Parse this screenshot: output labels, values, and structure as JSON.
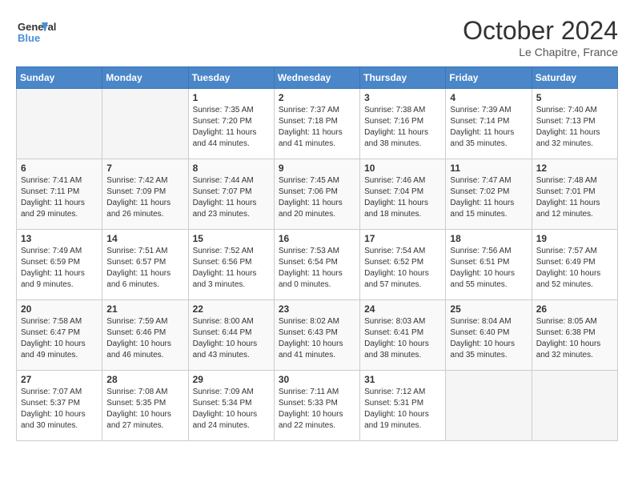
{
  "header": {
    "logo_line1": "General",
    "logo_line2": "Blue",
    "month": "October 2024",
    "location": "Le Chapitre, France"
  },
  "weekdays": [
    "Sunday",
    "Monday",
    "Tuesday",
    "Wednesday",
    "Thursday",
    "Friday",
    "Saturday"
  ],
  "weeks": [
    [
      {
        "day": "",
        "empty": true
      },
      {
        "day": "",
        "empty": true
      },
      {
        "day": "1",
        "sunrise": "Sunrise: 7:35 AM",
        "sunset": "Sunset: 7:20 PM",
        "daylight": "Daylight: 11 hours and 44 minutes."
      },
      {
        "day": "2",
        "sunrise": "Sunrise: 7:37 AM",
        "sunset": "Sunset: 7:18 PM",
        "daylight": "Daylight: 11 hours and 41 minutes."
      },
      {
        "day": "3",
        "sunrise": "Sunrise: 7:38 AM",
        "sunset": "Sunset: 7:16 PM",
        "daylight": "Daylight: 11 hours and 38 minutes."
      },
      {
        "day": "4",
        "sunrise": "Sunrise: 7:39 AM",
        "sunset": "Sunset: 7:14 PM",
        "daylight": "Daylight: 11 hours and 35 minutes."
      },
      {
        "day": "5",
        "sunrise": "Sunrise: 7:40 AM",
        "sunset": "Sunset: 7:13 PM",
        "daylight": "Daylight: 11 hours and 32 minutes."
      }
    ],
    [
      {
        "day": "6",
        "sunrise": "Sunrise: 7:41 AM",
        "sunset": "Sunset: 7:11 PM",
        "daylight": "Daylight: 11 hours and 29 minutes."
      },
      {
        "day": "7",
        "sunrise": "Sunrise: 7:42 AM",
        "sunset": "Sunset: 7:09 PM",
        "daylight": "Daylight: 11 hours and 26 minutes."
      },
      {
        "day": "8",
        "sunrise": "Sunrise: 7:44 AM",
        "sunset": "Sunset: 7:07 PM",
        "daylight": "Daylight: 11 hours and 23 minutes."
      },
      {
        "day": "9",
        "sunrise": "Sunrise: 7:45 AM",
        "sunset": "Sunset: 7:06 PM",
        "daylight": "Daylight: 11 hours and 20 minutes."
      },
      {
        "day": "10",
        "sunrise": "Sunrise: 7:46 AM",
        "sunset": "Sunset: 7:04 PM",
        "daylight": "Daylight: 11 hours and 18 minutes."
      },
      {
        "day": "11",
        "sunrise": "Sunrise: 7:47 AM",
        "sunset": "Sunset: 7:02 PM",
        "daylight": "Daylight: 11 hours and 15 minutes."
      },
      {
        "day": "12",
        "sunrise": "Sunrise: 7:48 AM",
        "sunset": "Sunset: 7:01 PM",
        "daylight": "Daylight: 11 hours and 12 minutes."
      }
    ],
    [
      {
        "day": "13",
        "sunrise": "Sunrise: 7:49 AM",
        "sunset": "Sunset: 6:59 PM",
        "daylight": "Daylight: 11 hours and 9 minutes."
      },
      {
        "day": "14",
        "sunrise": "Sunrise: 7:51 AM",
        "sunset": "Sunset: 6:57 PM",
        "daylight": "Daylight: 11 hours and 6 minutes."
      },
      {
        "day": "15",
        "sunrise": "Sunrise: 7:52 AM",
        "sunset": "Sunset: 6:56 PM",
        "daylight": "Daylight: 11 hours and 3 minutes."
      },
      {
        "day": "16",
        "sunrise": "Sunrise: 7:53 AM",
        "sunset": "Sunset: 6:54 PM",
        "daylight": "Daylight: 11 hours and 0 minutes."
      },
      {
        "day": "17",
        "sunrise": "Sunrise: 7:54 AM",
        "sunset": "Sunset: 6:52 PM",
        "daylight": "Daylight: 10 hours and 57 minutes."
      },
      {
        "day": "18",
        "sunrise": "Sunrise: 7:56 AM",
        "sunset": "Sunset: 6:51 PM",
        "daylight": "Daylight: 10 hours and 55 minutes."
      },
      {
        "day": "19",
        "sunrise": "Sunrise: 7:57 AM",
        "sunset": "Sunset: 6:49 PM",
        "daylight": "Daylight: 10 hours and 52 minutes."
      }
    ],
    [
      {
        "day": "20",
        "sunrise": "Sunrise: 7:58 AM",
        "sunset": "Sunset: 6:47 PM",
        "daylight": "Daylight: 10 hours and 49 minutes."
      },
      {
        "day": "21",
        "sunrise": "Sunrise: 7:59 AM",
        "sunset": "Sunset: 6:46 PM",
        "daylight": "Daylight: 10 hours and 46 minutes."
      },
      {
        "day": "22",
        "sunrise": "Sunrise: 8:00 AM",
        "sunset": "Sunset: 6:44 PM",
        "daylight": "Daylight: 10 hours and 43 minutes."
      },
      {
        "day": "23",
        "sunrise": "Sunrise: 8:02 AM",
        "sunset": "Sunset: 6:43 PM",
        "daylight": "Daylight: 10 hours and 41 minutes."
      },
      {
        "day": "24",
        "sunrise": "Sunrise: 8:03 AM",
        "sunset": "Sunset: 6:41 PM",
        "daylight": "Daylight: 10 hours and 38 minutes."
      },
      {
        "day": "25",
        "sunrise": "Sunrise: 8:04 AM",
        "sunset": "Sunset: 6:40 PM",
        "daylight": "Daylight: 10 hours and 35 minutes."
      },
      {
        "day": "26",
        "sunrise": "Sunrise: 8:05 AM",
        "sunset": "Sunset: 6:38 PM",
        "daylight": "Daylight: 10 hours and 32 minutes."
      }
    ],
    [
      {
        "day": "27",
        "sunrise": "Sunrise: 7:07 AM",
        "sunset": "Sunset: 5:37 PM",
        "daylight": "Daylight: 10 hours and 30 minutes."
      },
      {
        "day": "28",
        "sunrise": "Sunrise: 7:08 AM",
        "sunset": "Sunset: 5:35 PM",
        "daylight": "Daylight: 10 hours and 27 minutes."
      },
      {
        "day": "29",
        "sunrise": "Sunrise: 7:09 AM",
        "sunset": "Sunset: 5:34 PM",
        "daylight": "Daylight: 10 hours and 24 minutes."
      },
      {
        "day": "30",
        "sunrise": "Sunrise: 7:11 AM",
        "sunset": "Sunset: 5:33 PM",
        "daylight": "Daylight: 10 hours and 22 minutes."
      },
      {
        "day": "31",
        "sunrise": "Sunrise: 7:12 AM",
        "sunset": "Sunset: 5:31 PM",
        "daylight": "Daylight: 10 hours and 19 minutes."
      },
      {
        "day": "",
        "empty": true
      },
      {
        "day": "",
        "empty": true
      }
    ]
  ]
}
